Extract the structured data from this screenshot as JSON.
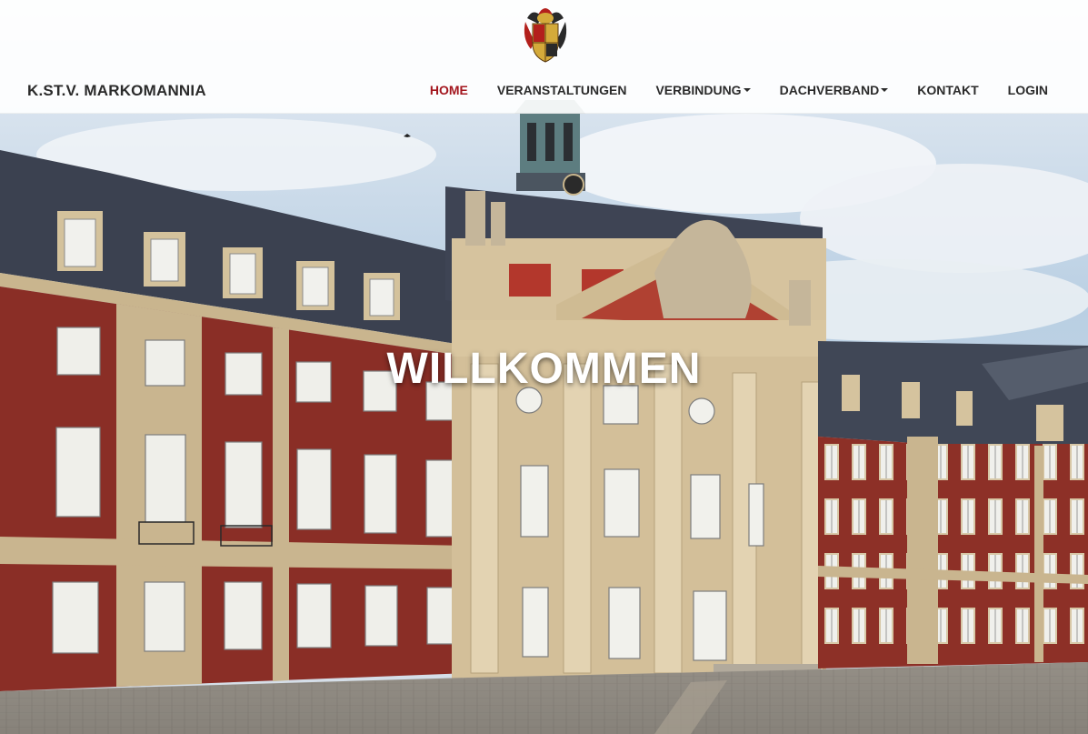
{
  "brand": {
    "name": "K.ST.V. MARKOMANNIA"
  },
  "nav": {
    "home": "HOME",
    "veranstaltungen": "VERANSTALTUNGEN",
    "verbindung": "VERBINDUNG",
    "dachverband": "DACHVERBAND",
    "kontakt": "KONTAKT",
    "login": "LOGIN",
    "active_item": "home"
  },
  "hero": {
    "headline": "WILLKOMMEN"
  },
  "colors": {
    "accent": "#a3161e",
    "nav_text": "#2b2b2b",
    "headline": "#ffffff",
    "brick": "#8a2e26",
    "sandstone": "#cdb890",
    "roof": "#3b4150",
    "sky": "#aec8e0",
    "cobblestone": "#8e8a83"
  },
  "icons": [
    "coat-of-arms-logo",
    "chevron-down-icon"
  ]
}
